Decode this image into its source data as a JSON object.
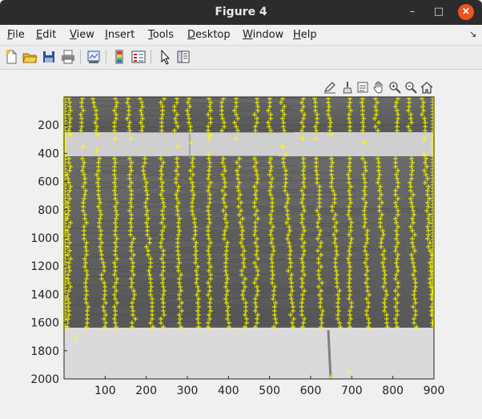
{
  "window": {
    "title": "Figure 4"
  },
  "window_controls": {
    "minimize": "–",
    "maximize": "□",
    "close": "×"
  },
  "menubar": {
    "items": [
      {
        "label": "File",
        "key": "F",
        "rest": "ile"
      },
      {
        "label": "Edit",
        "key": "E",
        "rest": "dit"
      },
      {
        "label": "View",
        "key": "V",
        "rest": "iew"
      },
      {
        "label": "Insert",
        "key": "I",
        "rest": "nsert"
      },
      {
        "label": "Tools",
        "key": "T",
        "rest": "ools"
      },
      {
        "label": "Desktop",
        "key": "D",
        "rest": "esktop"
      },
      {
        "label": "Window",
        "key": "W",
        "rest": "indow"
      },
      {
        "label": "Help",
        "key": "H",
        "rest": "elp"
      }
    ],
    "dock_arrow": "↘"
  },
  "toolbar": {
    "icons": [
      "new-figure-icon",
      "open-file-icon",
      "save-icon",
      "print-icon",
      "link-plot-icon",
      "insert-colorbar-icon",
      "insert-legend-icon",
      "edit-plot-pointer-icon",
      "property-inspector-icon"
    ]
  },
  "axes_toolbar": {
    "icons": [
      "edit-icon",
      "brush-icon",
      "datatips-icon",
      "pan-hand-icon",
      "zoom-in-icon",
      "zoom-out-icon",
      "home-icon"
    ]
  },
  "chart_data": {
    "type": "scatter",
    "description_visible": "grayscale image with yellow '+' feature markers",
    "xticks": [
      100,
      200,
      300,
      400,
      500,
      600,
      700,
      800,
      900
    ],
    "yticks": [
      200,
      400,
      600,
      800,
      1000,
      1200,
      1400,
      1600,
      1800,
      2000
    ],
    "xlim": [
      0,
      900
    ],
    "ylim": [
      0,
      2000
    ],
    "y_reversed": true,
    "marker": "+",
    "marker_color": "#ffff00",
    "xlabel": "",
    "ylabel": "",
    "title": ""
  },
  "colors": {
    "marker": "#ffff00",
    "titlebar": "#2c2c2c",
    "close": "#e95420"
  }
}
